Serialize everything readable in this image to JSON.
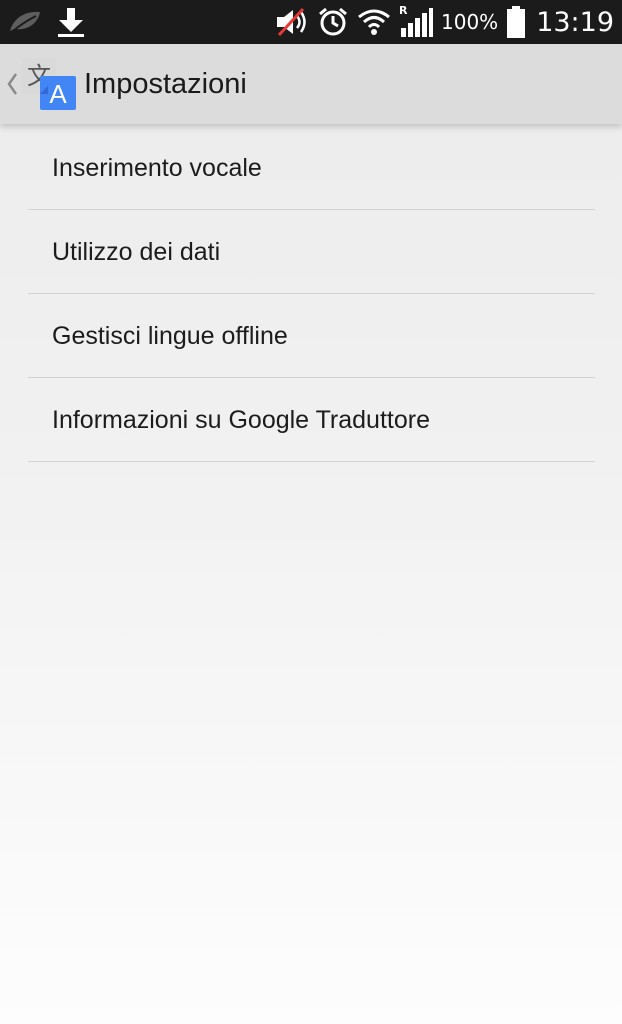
{
  "status_bar": {
    "left_icons": [
      "leaf-icon",
      "download-icon"
    ],
    "right_icons": [
      "volume-muted-icon",
      "alarm-icon",
      "wifi-icon",
      "signal-roaming-icon",
      "battery-full-icon"
    ],
    "roaming_indicator": "R",
    "battery_percent": "100%",
    "time": "13:19"
  },
  "action_bar": {
    "title": "Impostazioni",
    "app_icon_glyph_front": "A",
    "app_icon_glyph_back": "文",
    "colors": {
      "background": "#dcdcdc",
      "app_icon_blue": "#4285f4",
      "app_icon_grey": "#d9d9d9"
    }
  },
  "settings": {
    "items": [
      {
        "label": "Inserimento vocale"
      },
      {
        "label": "Utilizzo dei dati"
      },
      {
        "label": "Gestisci lingue offline"
      },
      {
        "label": "Informazioni su Google Traduttore"
      }
    ]
  }
}
